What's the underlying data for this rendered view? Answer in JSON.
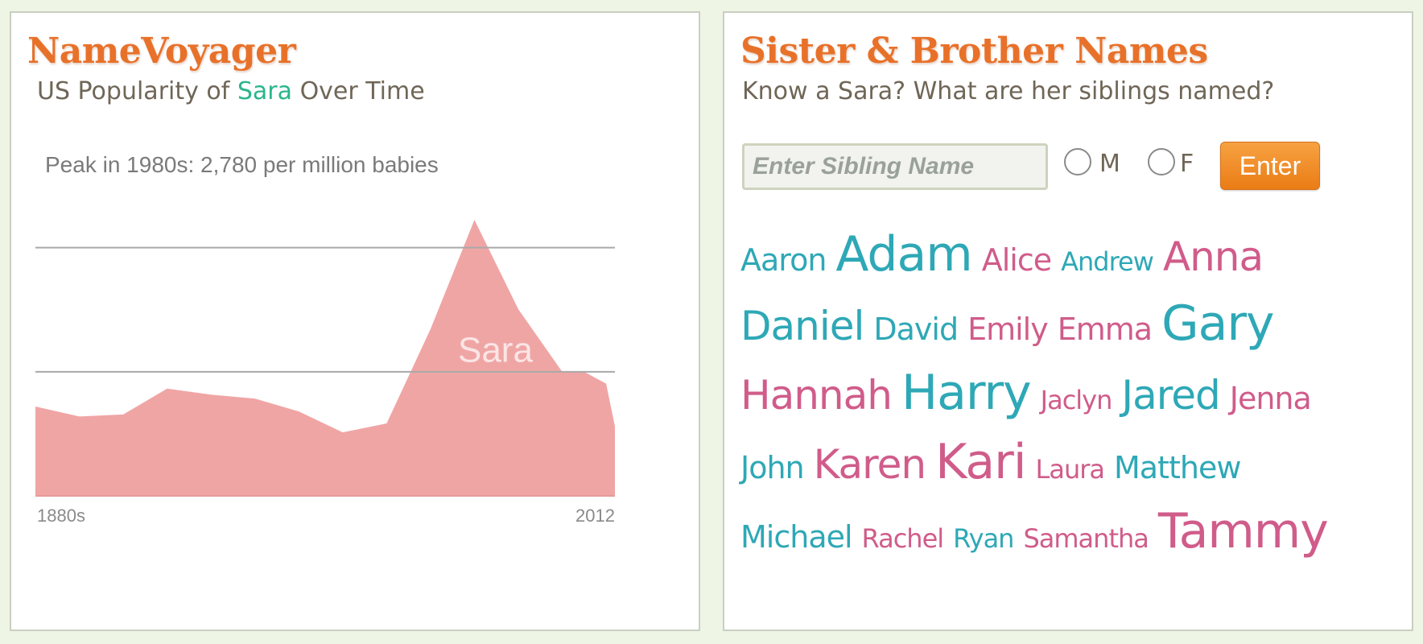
{
  "namevoyager": {
    "title": "NameVoyager",
    "subtitle_prefix": "US Popularity of ",
    "name": "Sara",
    "subtitle_suffix": " Over Time"
  },
  "chart_data": {
    "type": "area",
    "title": "Peak in 1980s: 2,780 per million babies",
    "series": [
      {
        "name": "Sara",
        "color": "#f0a5a5"
      }
    ],
    "x": [
      1880,
      1890,
      1900,
      1910,
      1920,
      1930,
      1940,
      1950,
      1960,
      1970,
      1980,
      1990,
      2000,
      2005,
      2010,
      2012
    ],
    "values": [
      900,
      800,
      820,
      1080,
      1020,
      980,
      850,
      640,
      730,
      1680,
      2780,
      1880,
      1250,
      1250,
      1130,
      700
    ],
    "x_tick_labels": [
      "1880s",
      "2012"
    ],
    "ylim": [
      0,
      3000
    ],
    "grid": true,
    "gridlines_y": [
      1250,
      2500
    ]
  },
  "siblings": {
    "title": "Sister & Brother Names",
    "subtitle": "Know a Sara? What are her siblings named?",
    "input_placeholder": "Enter Sibling Name",
    "radio_m": "M",
    "radio_f": "F",
    "enter_label": "Enter",
    "colors": {
      "boy": "#2ea8b6",
      "girl": "#d05c8a"
    },
    "names": [
      [
        "Aaron",
        "Adam",
        "Alice",
        "Andrew",
        "Anna"
      ],
      [
        "Daniel",
        "David",
        "Emily",
        "Emma",
        "Gary"
      ],
      [
        "Hannah",
        "Harry",
        "Jaclyn",
        "Jared",
        "Jenna"
      ],
      [
        "John",
        "Karen",
        "Kari",
        "Laura",
        "Matthew"
      ],
      [
        "Michael",
        "Rachel",
        "Ryan",
        "Samantha",
        "Tammy"
      ]
    ]
  }
}
